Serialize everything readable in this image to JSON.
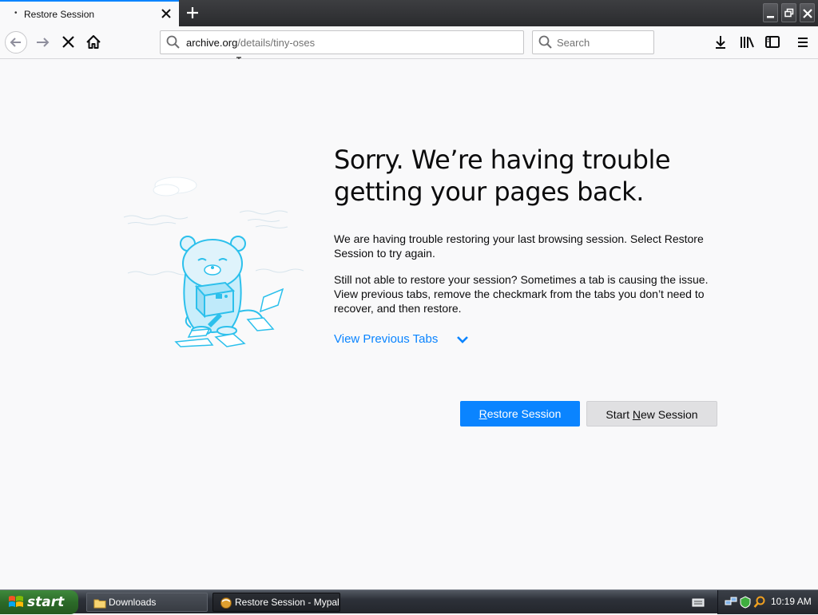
{
  "tab": {
    "title": "Restore Session",
    "dot": "•"
  },
  "url": {
    "host": "archive.org",
    "path": "/details/tiny-oses"
  },
  "search": {
    "placeholder": "Search"
  },
  "page": {
    "title": "Sorry. We’re having trouble getting your pages back.",
    "para1": "We are having trouble restoring your last browsing session. Select Restore Session to try again.",
    "para2": "Still not able to restore your session? Sometimes a tab is causing the issue. View previous tabs, remove the checkmark from the tabs you don’t need to recover, and then restore.",
    "view_previous": "View Previous Tabs",
    "restore_pre": "",
    "restore_key": "R",
    "restore_post": "estore Session",
    "new_pre": "Start ",
    "new_key": "N",
    "new_post": "ew Session"
  },
  "taskbar": {
    "start": "start",
    "downloads": "Downloads",
    "active_window": "Restore Session - Mypal",
    "clock": "10:19 AM"
  },
  "colors": {
    "accent": "#0a84ff",
    "taskbar": "#2d3139",
    "start_green": "#3f8a3c"
  }
}
